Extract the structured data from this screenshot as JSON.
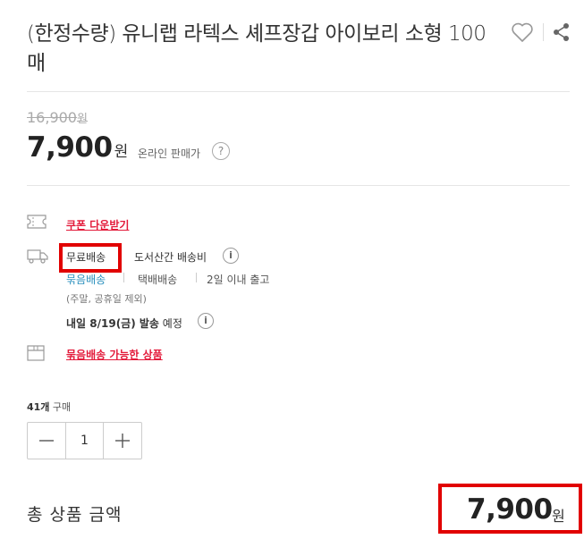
{
  "product": {
    "title": "(한정수량) 유니랩 라텍스 셰프장갑 아이보리 소형 100매"
  },
  "price": {
    "original": "16,900",
    "original_unit": "원",
    "sale": "7,900",
    "sale_unit": "원",
    "label": "온라인 판매가",
    "help": "?"
  },
  "coupon": {
    "label": "쿠폰 다운받기"
  },
  "shipping": {
    "free": "무료배송",
    "fee_label": "도서산간 배송비",
    "info": "i",
    "options": [
      "묶음배송",
      "택배배송",
      "2일 이내 출고"
    ],
    "note": "(주말, 공휴일 제외)",
    "arrival_date": "내일 8/19(금) 발송",
    "arrival_suffix": " 예정"
  },
  "bundle": {
    "label": "묶음배송 가능한 상품"
  },
  "purchase": {
    "count": "41개",
    "suffix": " 구매"
  },
  "quantity": {
    "value": "1"
  },
  "total": {
    "label": "총 상품 금액",
    "value": "7,900",
    "unit": "원"
  },
  "colors": {
    "accent_red": "#e31b3b",
    "highlight": "#e10000",
    "link_blue": "#2a8fbd"
  },
  "icons": [
    "heart-icon",
    "share-icon",
    "coupon-icon",
    "truck-icon",
    "box-icon",
    "minus-icon",
    "plus-icon"
  ]
}
